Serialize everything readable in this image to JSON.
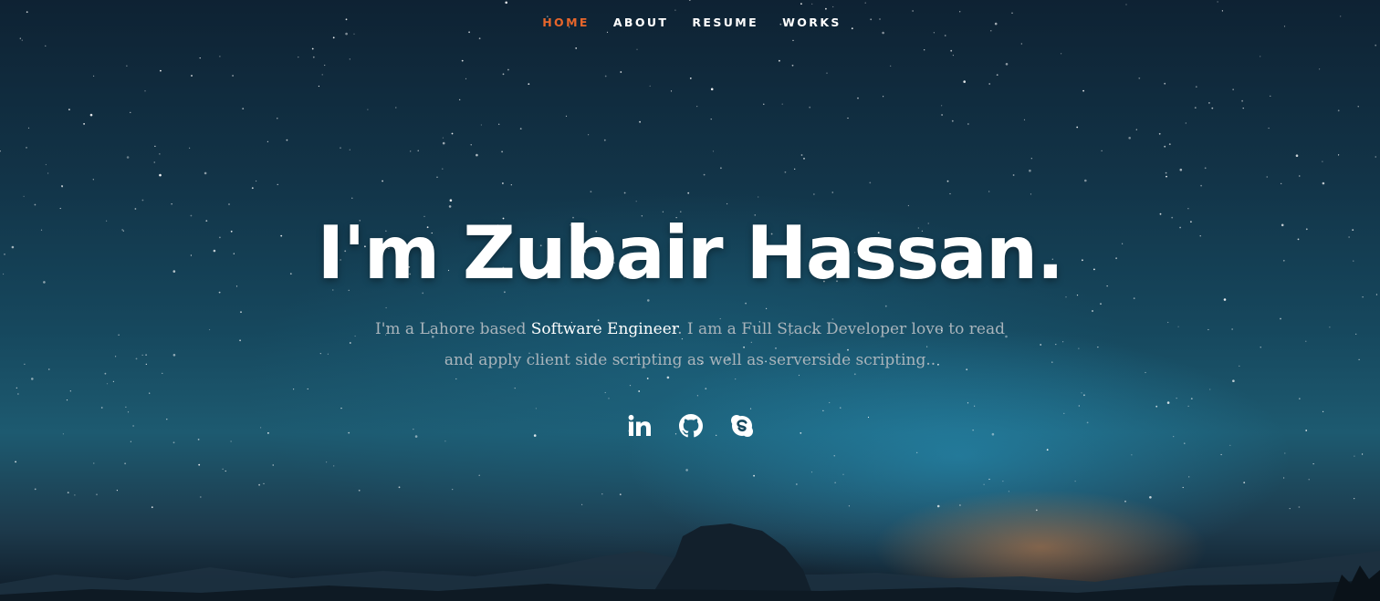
{
  "nav": {
    "items": [
      {
        "label": "HOME",
        "active": true
      },
      {
        "label": "ABOUT",
        "active": false
      },
      {
        "label": "RESUME",
        "active": false
      },
      {
        "label": "WORKS",
        "active": false
      }
    ],
    "active_color": "#e7662b"
  },
  "banner": {
    "title": "I'm Zubair Hassan.",
    "intro_before": "I'm a Lahore based ",
    "intro_highlight": "Software Engineer",
    "intro_after": ". I am a Full Stack Developer love to read and apply client side scripting as well as serverside scripting.."
  },
  "social": [
    {
      "icon": "linkedin-icon"
    },
    {
      "icon": "github-icon"
    },
    {
      "icon": "skype-icon"
    }
  ]
}
